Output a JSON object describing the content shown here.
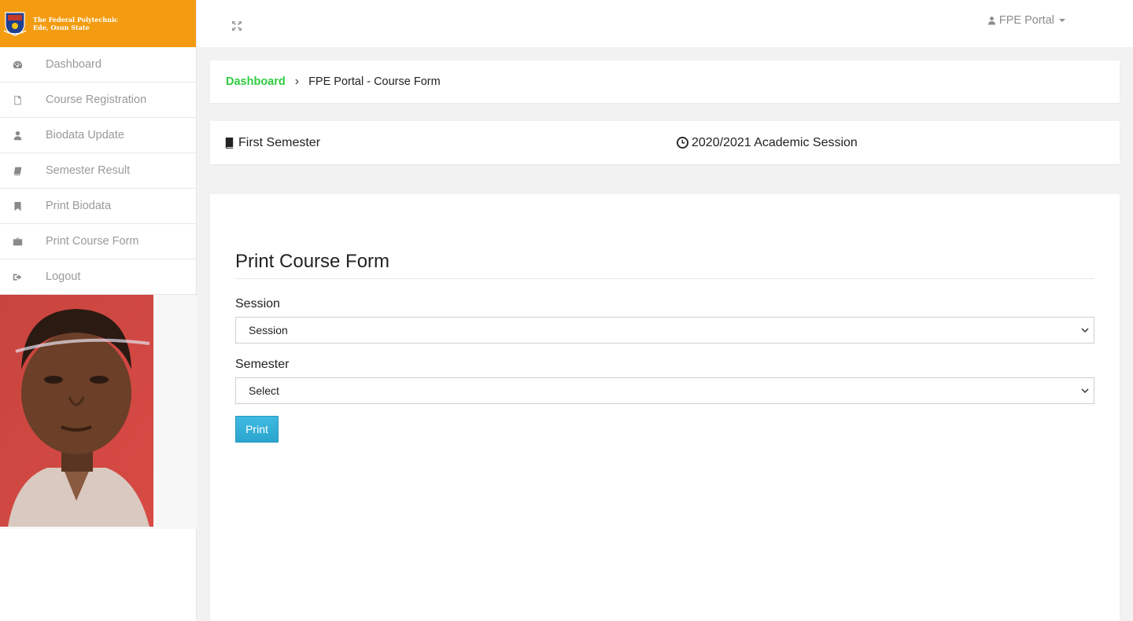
{
  "brand": {
    "line1": "The Federal Polytechnic",
    "line2": "Ede, Osun State",
    "color": "#f39c12"
  },
  "sidebar": {
    "items": [
      {
        "label": "Dashboard",
        "icon": "dashboard-icon"
      },
      {
        "label": "Course Registration",
        "icon": "file-icon"
      },
      {
        "label": "Biodata Update",
        "icon": "user-icon"
      },
      {
        "label": "Semester Result",
        "icon": "book-icon"
      },
      {
        "label": "Print Biodata",
        "icon": "bookmark-icon"
      },
      {
        "label": "Print Course Form",
        "icon": "briefcase-icon"
      },
      {
        "label": "Logout",
        "icon": "sign-out-icon"
      }
    ]
  },
  "topbar": {
    "user_label": "FPE Portal"
  },
  "breadcrumb": {
    "home": "Dashboard",
    "separator": "›",
    "current": "FPE Portal - Course Form"
  },
  "info": {
    "semester": "First Semester",
    "session": "2020/2021 Academic Session"
  },
  "form": {
    "title": "Print Course Form",
    "session_label": "Session",
    "session_value": "Session",
    "semester_label": "Semester",
    "semester_value": "Select",
    "print_label": "Print"
  },
  "colors": {
    "accent_green": "#2ecc40",
    "button_blue": "#31b0d5"
  }
}
